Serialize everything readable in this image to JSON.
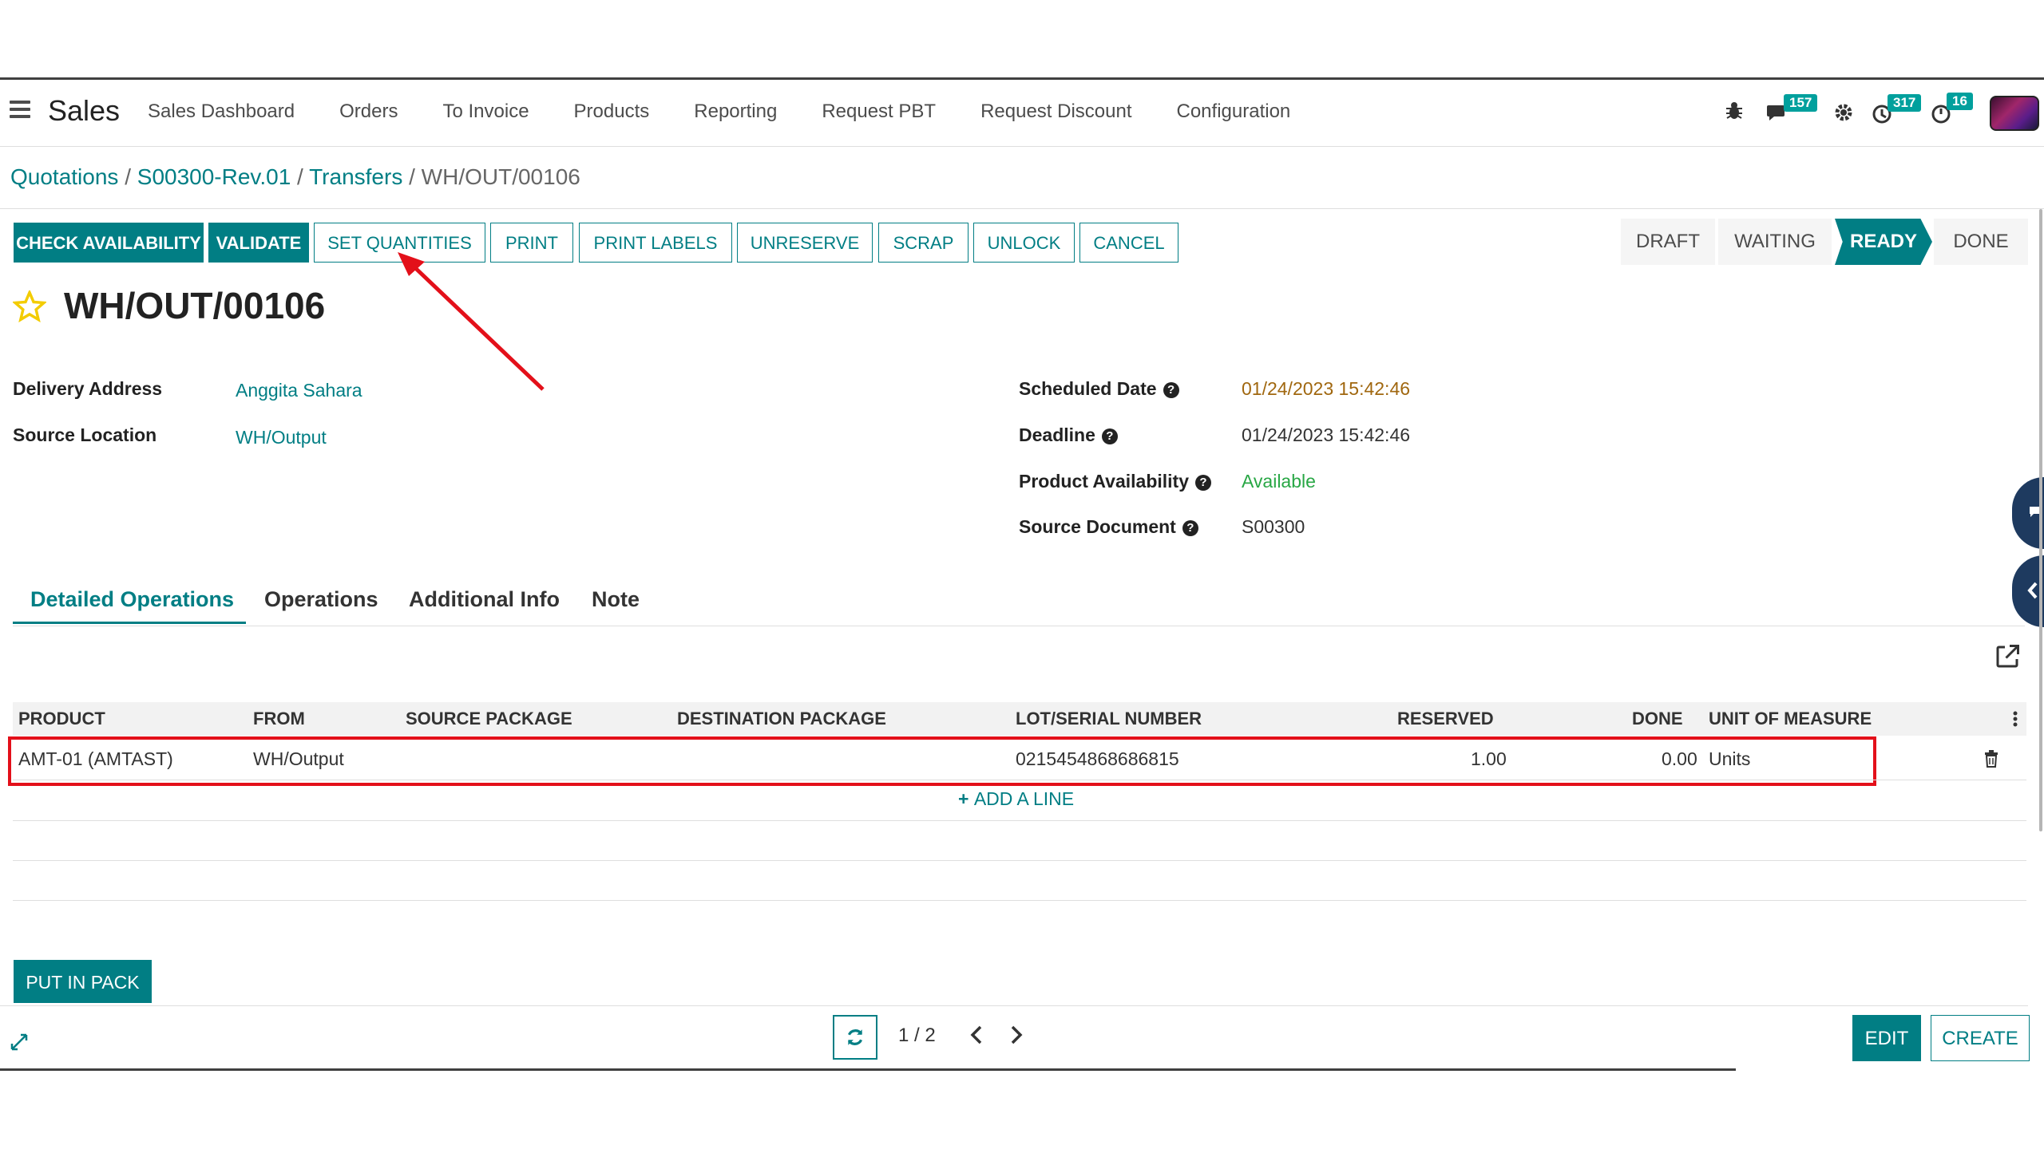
{
  "nav": {
    "app_name": "Sales",
    "menu": [
      "Sales Dashboard",
      "Orders",
      "To Invoice",
      "Products",
      "Reporting",
      "Request PBT",
      "Request Discount",
      "Configuration"
    ],
    "badges": {
      "messages": "157",
      "activities": "317",
      "timer": "16"
    }
  },
  "breadcrumb": {
    "items": [
      "Quotations",
      "S00300-Rev.01",
      "Transfers"
    ],
    "current": "WH/OUT/00106",
    "separator": " / "
  },
  "toolbar": {
    "check_availability": "CHECK AVAILABILITY",
    "validate": "VALIDATE",
    "set_quantities": "SET QUANTITIES",
    "print": "PRINT",
    "print_labels": "PRINT LABELS",
    "unreserve": "UNRESERVE",
    "scrap": "SCRAP",
    "unlock": "UNLOCK",
    "cancel": "CANCEL"
  },
  "statusbar": {
    "states": [
      "DRAFT",
      "WAITING",
      "READY",
      "DONE"
    ],
    "active": "READY"
  },
  "record": {
    "title": "WH/OUT/00106",
    "delivery_address_label": "Delivery Address",
    "delivery_address": "Anggita Sahara",
    "source_location_label": "Source Location",
    "source_location": "WH/Output",
    "scheduled_date_label": "Scheduled Date",
    "scheduled_date": "01/24/2023 15:42:46",
    "deadline_label": "Deadline",
    "deadline": "01/24/2023 15:42:46",
    "availability_label": "Product Availability",
    "availability": "Available",
    "source_document_label": "Source Document",
    "source_document": "S00300"
  },
  "tabs": [
    "Detailed Operations",
    "Operations",
    "Additional Info",
    "Note"
  ],
  "table": {
    "columns": [
      "PRODUCT",
      "FROM",
      "SOURCE PACKAGE",
      "DESTINATION PACKAGE",
      "LOT/SERIAL NUMBER",
      "RESERVED",
      "DONE",
      "UNIT OF MEASURE"
    ],
    "rows": [
      {
        "product": "AMT-01 (AMTAST)",
        "from": "WH/Output",
        "source_package": "",
        "destination_package": "",
        "lot": "0215454868686815",
        "reserved": "1.00",
        "done": "0.00",
        "uom": "Units"
      }
    ],
    "add_line": "ADD A LINE"
  },
  "footer": {
    "put_in_pack": "PUT IN PACK",
    "pager": "1 / 2",
    "edit": "EDIT",
    "create": "CREATE"
  },
  "colors": {
    "accent": "#017e84",
    "highlight": "#e3101a",
    "star": "#f3cc00",
    "date_warning": "#a0670f",
    "available": "#28a745"
  }
}
